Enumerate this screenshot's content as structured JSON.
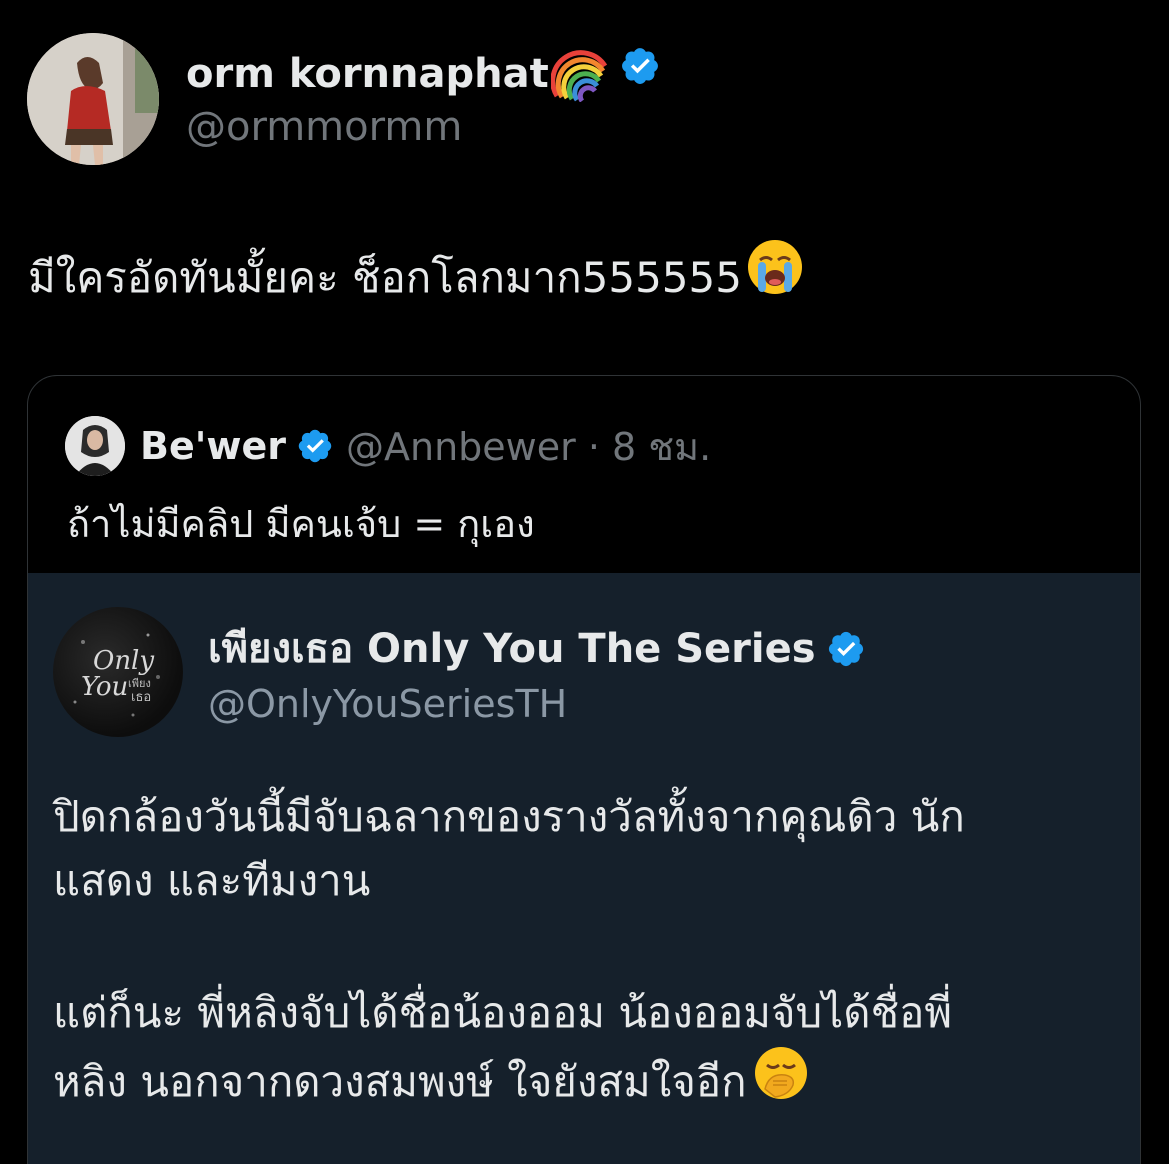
{
  "author": {
    "display_name": "orm kornnaphat",
    "handle": "@ormmormm",
    "badge_icon": "verified-badge-icon",
    "name_emoji": "rainbow-emoji"
  },
  "tweet": {
    "text": "มีใครอัดทันมั้ยคะ ช็อกโลกมาก555555",
    "emoji": "loudly-crying-face-emoji"
  },
  "quote": {
    "display_name": "Be'wer",
    "handle_time": "@Annbewer · 8 ชม.",
    "text": "ถ้าไม่มีคลิป มีคนเจ้บ = กุเอง"
  },
  "embedded": {
    "display_name": "เพียงเธอ Only You The Series",
    "handle": "@OnlyYouSeriesTH",
    "avatar_text_1": "Only",
    "avatar_text_2": "You",
    "avatar_text_3": "เพียง",
    "avatar_text_4": "เธอ",
    "para1_line1": "ปิดกล้องวันนี้มีจับฉลากของรางวัลทั้งจากคุณดิว นัก",
    "para1_line2": "แสดง และทีมงาน",
    "para2_line1": "แต่ก็นะ พี่หลิงจับได้ชื่อน้องออม น้องออมจับได้ชื่อพี่",
    "para2_line2": "หลิง นอกจากดวงสมพงษ์ ใจยังสมใจอีก",
    "para2_emoji": "face-with-hand-over-mouth-emoji"
  },
  "colors": {
    "background": "#000000",
    "embedded_background": "#15202b",
    "verified_blue": "#1d9bf0",
    "text_primary": "#e7e9ea",
    "text_secondary": "#71767b"
  }
}
